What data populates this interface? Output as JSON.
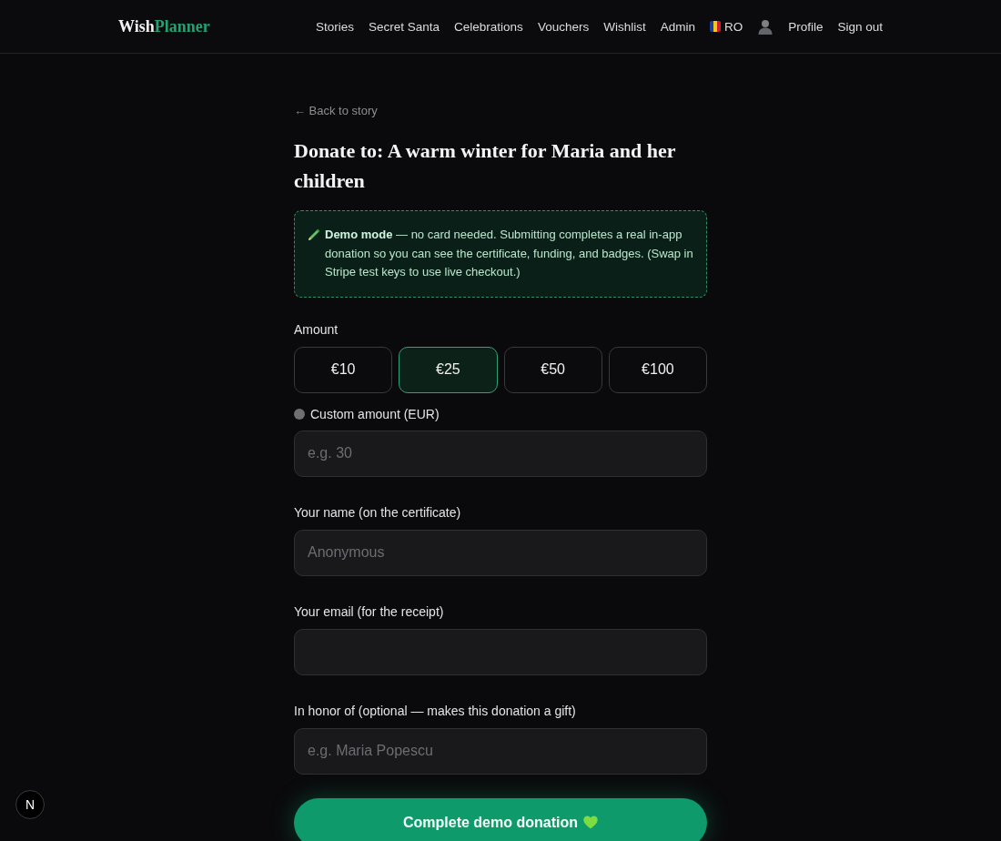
{
  "navbar": {
    "logo": {
      "text": "Wish",
      "accent": "Planner"
    },
    "links": [
      {
        "label": "Stories"
      },
      {
        "label": "Secret Santa"
      },
      {
        "label": "Celebrations"
      },
      {
        "label": "Vouchers"
      },
      {
        "label": "Wishlist"
      },
      {
        "label": "Admin"
      }
    ],
    "language": {
      "label": "RO"
    },
    "account_links": [
      {
        "label": "Profile"
      },
      {
        "label": "Sign out"
      }
    ]
  },
  "back_link": {
    "label": "← Back to story"
  },
  "title": "Donate to: A warm winter for Maria and her children",
  "demo_notice": {
    "text": "**Demo mode** — no card needed. Submitting completes a real in-app donation so you can see the certificate, funding, and badges. (Swap in Stripe test keys to use live checkout.)"
  },
  "amount": {
    "label": "Amount",
    "options": [
      {
        "label": "€10",
        "selected": false
      },
      {
        "label": "€25",
        "selected": true
      },
      {
        "label": "€50",
        "selected": false
      },
      {
        "label": "€100",
        "selected": false
      }
    ],
    "custom": {
      "label": "Custom amount (EUR)",
      "selected": false,
      "placeholder": "e.g. 30"
    }
  },
  "fields": [
    {
      "label": "Your name (on the certificate)",
      "placeholder": "Anonymous"
    },
    {
      "label": "Your email (for the receipt)"
    },
    {
      "label": "In honor of (optional — makes this donation a gift)",
      "placeholder": "e.g. Maria Popescu"
    }
  ],
  "submit_button": {
    "label": "Complete demo donation"
  },
  "dev_badge": {
    "label": "N"
  }
}
